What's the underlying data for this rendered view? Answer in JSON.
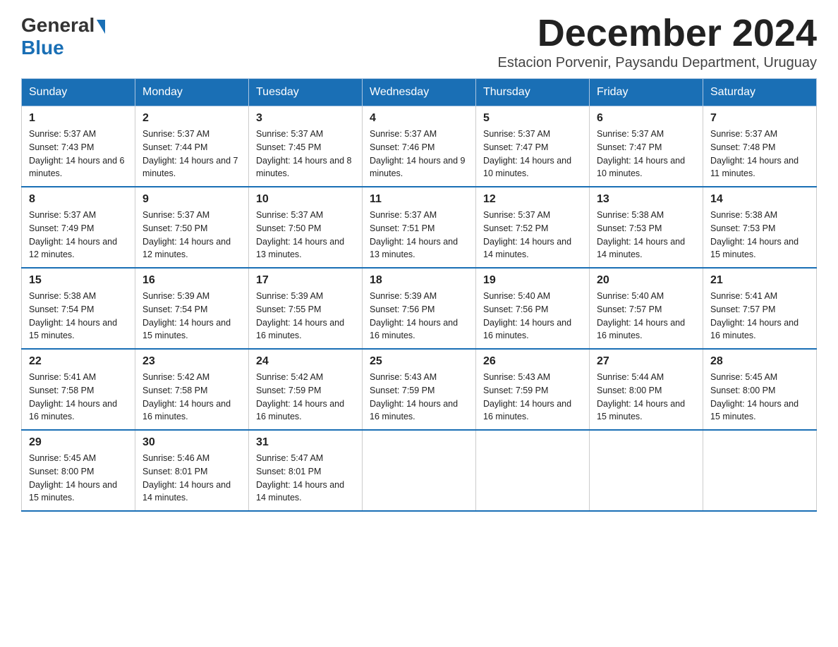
{
  "header": {
    "logo_general": "General",
    "logo_blue": "Blue",
    "month_title": "December 2024",
    "location": "Estacion Porvenir, Paysandu Department, Uruguay"
  },
  "days_of_week": [
    "Sunday",
    "Monday",
    "Tuesday",
    "Wednesday",
    "Thursday",
    "Friday",
    "Saturday"
  ],
  "weeks": [
    [
      {
        "day": "1",
        "sunrise": "Sunrise: 5:37 AM",
        "sunset": "Sunset: 7:43 PM",
        "daylight": "Daylight: 14 hours and 6 minutes."
      },
      {
        "day": "2",
        "sunrise": "Sunrise: 5:37 AM",
        "sunset": "Sunset: 7:44 PM",
        "daylight": "Daylight: 14 hours and 7 minutes."
      },
      {
        "day": "3",
        "sunrise": "Sunrise: 5:37 AM",
        "sunset": "Sunset: 7:45 PM",
        "daylight": "Daylight: 14 hours and 8 minutes."
      },
      {
        "day": "4",
        "sunrise": "Sunrise: 5:37 AM",
        "sunset": "Sunset: 7:46 PM",
        "daylight": "Daylight: 14 hours and 9 minutes."
      },
      {
        "day": "5",
        "sunrise": "Sunrise: 5:37 AM",
        "sunset": "Sunset: 7:47 PM",
        "daylight": "Daylight: 14 hours and 10 minutes."
      },
      {
        "day": "6",
        "sunrise": "Sunrise: 5:37 AM",
        "sunset": "Sunset: 7:47 PM",
        "daylight": "Daylight: 14 hours and 10 minutes."
      },
      {
        "day": "7",
        "sunrise": "Sunrise: 5:37 AM",
        "sunset": "Sunset: 7:48 PM",
        "daylight": "Daylight: 14 hours and 11 minutes."
      }
    ],
    [
      {
        "day": "8",
        "sunrise": "Sunrise: 5:37 AM",
        "sunset": "Sunset: 7:49 PM",
        "daylight": "Daylight: 14 hours and 12 minutes."
      },
      {
        "day": "9",
        "sunrise": "Sunrise: 5:37 AM",
        "sunset": "Sunset: 7:50 PM",
        "daylight": "Daylight: 14 hours and 12 minutes."
      },
      {
        "day": "10",
        "sunrise": "Sunrise: 5:37 AM",
        "sunset": "Sunset: 7:50 PM",
        "daylight": "Daylight: 14 hours and 13 minutes."
      },
      {
        "day": "11",
        "sunrise": "Sunrise: 5:37 AM",
        "sunset": "Sunset: 7:51 PM",
        "daylight": "Daylight: 14 hours and 13 minutes."
      },
      {
        "day": "12",
        "sunrise": "Sunrise: 5:37 AM",
        "sunset": "Sunset: 7:52 PM",
        "daylight": "Daylight: 14 hours and 14 minutes."
      },
      {
        "day": "13",
        "sunrise": "Sunrise: 5:38 AM",
        "sunset": "Sunset: 7:53 PM",
        "daylight": "Daylight: 14 hours and 14 minutes."
      },
      {
        "day": "14",
        "sunrise": "Sunrise: 5:38 AM",
        "sunset": "Sunset: 7:53 PM",
        "daylight": "Daylight: 14 hours and 15 minutes."
      }
    ],
    [
      {
        "day": "15",
        "sunrise": "Sunrise: 5:38 AM",
        "sunset": "Sunset: 7:54 PM",
        "daylight": "Daylight: 14 hours and 15 minutes."
      },
      {
        "day": "16",
        "sunrise": "Sunrise: 5:39 AM",
        "sunset": "Sunset: 7:54 PM",
        "daylight": "Daylight: 14 hours and 15 minutes."
      },
      {
        "day": "17",
        "sunrise": "Sunrise: 5:39 AM",
        "sunset": "Sunset: 7:55 PM",
        "daylight": "Daylight: 14 hours and 16 minutes."
      },
      {
        "day": "18",
        "sunrise": "Sunrise: 5:39 AM",
        "sunset": "Sunset: 7:56 PM",
        "daylight": "Daylight: 14 hours and 16 minutes."
      },
      {
        "day": "19",
        "sunrise": "Sunrise: 5:40 AM",
        "sunset": "Sunset: 7:56 PM",
        "daylight": "Daylight: 14 hours and 16 minutes."
      },
      {
        "day": "20",
        "sunrise": "Sunrise: 5:40 AM",
        "sunset": "Sunset: 7:57 PM",
        "daylight": "Daylight: 14 hours and 16 minutes."
      },
      {
        "day": "21",
        "sunrise": "Sunrise: 5:41 AM",
        "sunset": "Sunset: 7:57 PM",
        "daylight": "Daylight: 14 hours and 16 minutes."
      }
    ],
    [
      {
        "day": "22",
        "sunrise": "Sunrise: 5:41 AM",
        "sunset": "Sunset: 7:58 PM",
        "daylight": "Daylight: 14 hours and 16 minutes."
      },
      {
        "day": "23",
        "sunrise": "Sunrise: 5:42 AM",
        "sunset": "Sunset: 7:58 PM",
        "daylight": "Daylight: 14 hours and 16 minutes."
      },
      {
        "day": "24",
        "sunrise": "Sunrise: 5:42 AM",
        "sunset": "Sunset: 7:59 PM",
        "daylight": "Daylight: 14 hours and 16 minutes."
      },
      {
        "day": "25",
        "sunrise": "Sunrise: 5:43 AM",
        "sunset": "Sunset: 7:59 PM",
        "daylight": "Daylight: 14 hours and 16 minutes."
      },
      {
        "day": "26",
        "sunrise": "Sunrise: 5:43 AM",
        "sunset": "Sunset: 7:59 PM",
        "daylight": "Daylight: 14 hours and 16 minutes."
      },
      {
        "day": "27",
        "sunrise": "Sunrise: 5:44 AM",
        "sunset": "Sunset: 8:00 PM",
        "daylight": "Daylight: 14 hours and 15 minutes."
      },
      {
        "day": "28",
        "sunrise": "Sunrise: 5:45 AM",
        "sunset": "Sunset: 8:00 PM",
        "daylight": "Daylight: 14 hours and 15 minutes."
      }
    ],
    [
      {
        "day": "29",
        "sunrise": "Sunrise: 5:45 AM",
        "sunset": "Sunset: 8:00 PM",
        "daylight": "Daylight: 14 hours and 15 minutes."
      },
      {
        "day": "30",
        "sunrise": "Sunrise: 5:46 AM",
        "sunset": "Sunset: 8:01 PM",
        "daylight": "Daylight: 14 hours and 14 minutes."
      },
      {
        "day": "31",
        "sunrise": "Sunrise: 5:47 AM",
        "sunset": "Sunset: 8:01 PM",
        "daylight": "Daylight: 14 hours and 14 minutes."
      },
      null,
      null,
      null,
      null
    ]
  ]
}
